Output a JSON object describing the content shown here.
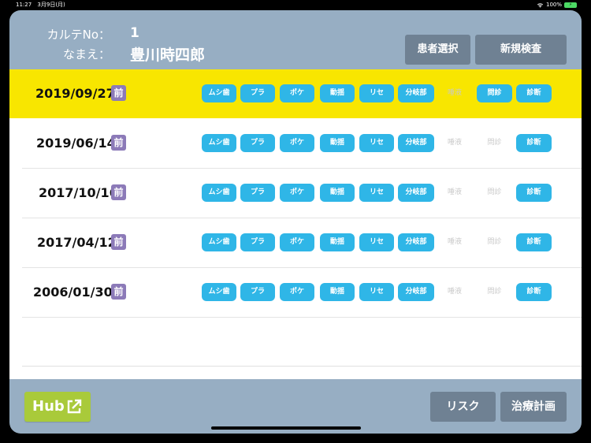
{
  "status_bar": {
    "time": "11:27",
    "date": "3月9日(月)",
    "battery": "100%"
  },
  "header": {
    "karte_label": "カルテNo：",
    "karte_value": "1",
    "name_label": "なまえ：",
    "name_value": "豊川時四郎",
    "patient_select_button": "患者選択",
    "new_exam_button": "新規検査"
  },
  "prefix_badge": "前",
  "chip_labels": [
    "ムシ歯",
    "プラ",
    "ポケ",
    "動揺",
    "リセ",
    "分岐部",
    "唾液",
    "問診",
    "診断"
  ],
  "records": [
    {
      "date": "2019/09/27",
      "selected": true,
      "enabled": [
        true,
        true,
        true,
        true,
        true,
        true,
        false,
        true,
        true
      ]
    },
    {
      "date": "2019/06/14",
      "selected": false,
      "enabled": [
        true,
        true,
        true,
        true,
        true,
        true,
        false,
        false,
        true
      ]
    },
    {
      "date": "2017/10/16",
      "selected": false,
      "enabled": [
        true,
        true,
        true,
        true,
        true,
        true,
        false,
        false,
        true
      ]
    },
    {
      "date": "2017/04/12",
      "selected": false,
      "enabled": [
        true,
        true,
        true,
        true,
        true,
        true,
        false,
        false,
        true
      ]
    },
    {
      "date": "2006/01/30",
      "selected": false,
      "enabled": [
        true,
        true,
        true,
        true,
        true,
        true,
        false,
        false,
        true
      ]
    }
  ],
  "footer": {
    "hub_label": "Hub",
    "risk_button": "リスク",
    "plan_button": "治療計画"
  },
  "colors": {
    "header_bg": "#97aec3",
    "button_bg": "#6f8193",
    "selected_row": "#f8e600",
    "chip": "#2fb6e7",
    "badge": "#8c7ab8",
    "hub": "#a9ca3a"
  }
}
